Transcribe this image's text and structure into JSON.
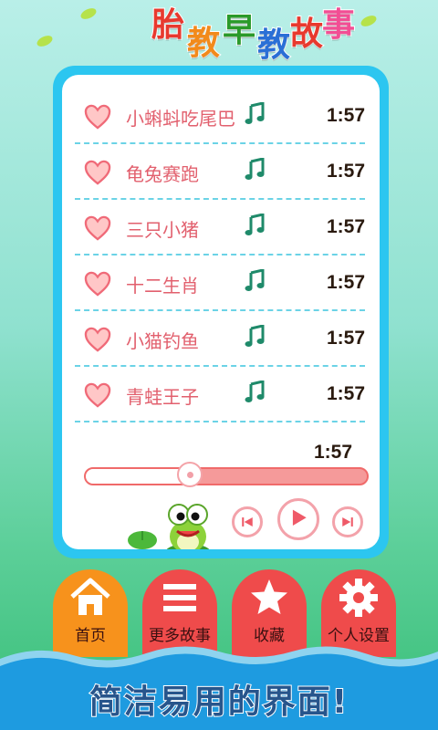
{
  "app": {
    "title_chars": [
      "胎",
      "教",
      "早",
      "教",
      "故",
      "事"
    ],
    "title_colors": [
      "#e8392e",
      "#f28a1b",
      "#2a9a2a",
      "#2a6fd6",
      "#e8392e",
      "#f24e94"
    ]
  },
  "playlist": [
    {
      "title": "小蝌蚪吃尾巴",
      "duration": "1:57"
    },
    {
      "title": "龟兔赛跑",
      "duration": "1:57"
    },
    {
      "title": "三只小猪",
      "duration": "1:57"
    },
    {
      "title": "十二生肖",
      "duration": "1:57"
    },
    {
      "title": "小猫钓鱼",
      "duration": "1:57"
    },
    {
      "title": "青蛙王子",
      "duration": "1:57"
    }
  ],
  "player": {
    "total_time": "1:57",
    "progress_fraction": 0.37
  },
  "nav": [
    {
      "label": "首页",
      "icon": "home-icon",
      "color": "#f7921c"
    },
    {
      "label": "更多故事",
      "icon": "menu-icon",
      "color": "#ef4b4b"
    },
    {
      "label": "收藏",
      "icon": "star-icon",
      "color": "#ef4b4b"
    },
    {
      "label": "个人设置",
      "icon": "gear-icon",
      "color": "#ef4b4b"
    }
  ],
  "slogan": "简洁易用的界面!",
  "colors": {
    "panel_border": "#2cc6f0",
    "song_text": "#e2606e",
    "divider": "#6bd3e6",
    "accent_pink": "#f3a2aa"
  }
}
